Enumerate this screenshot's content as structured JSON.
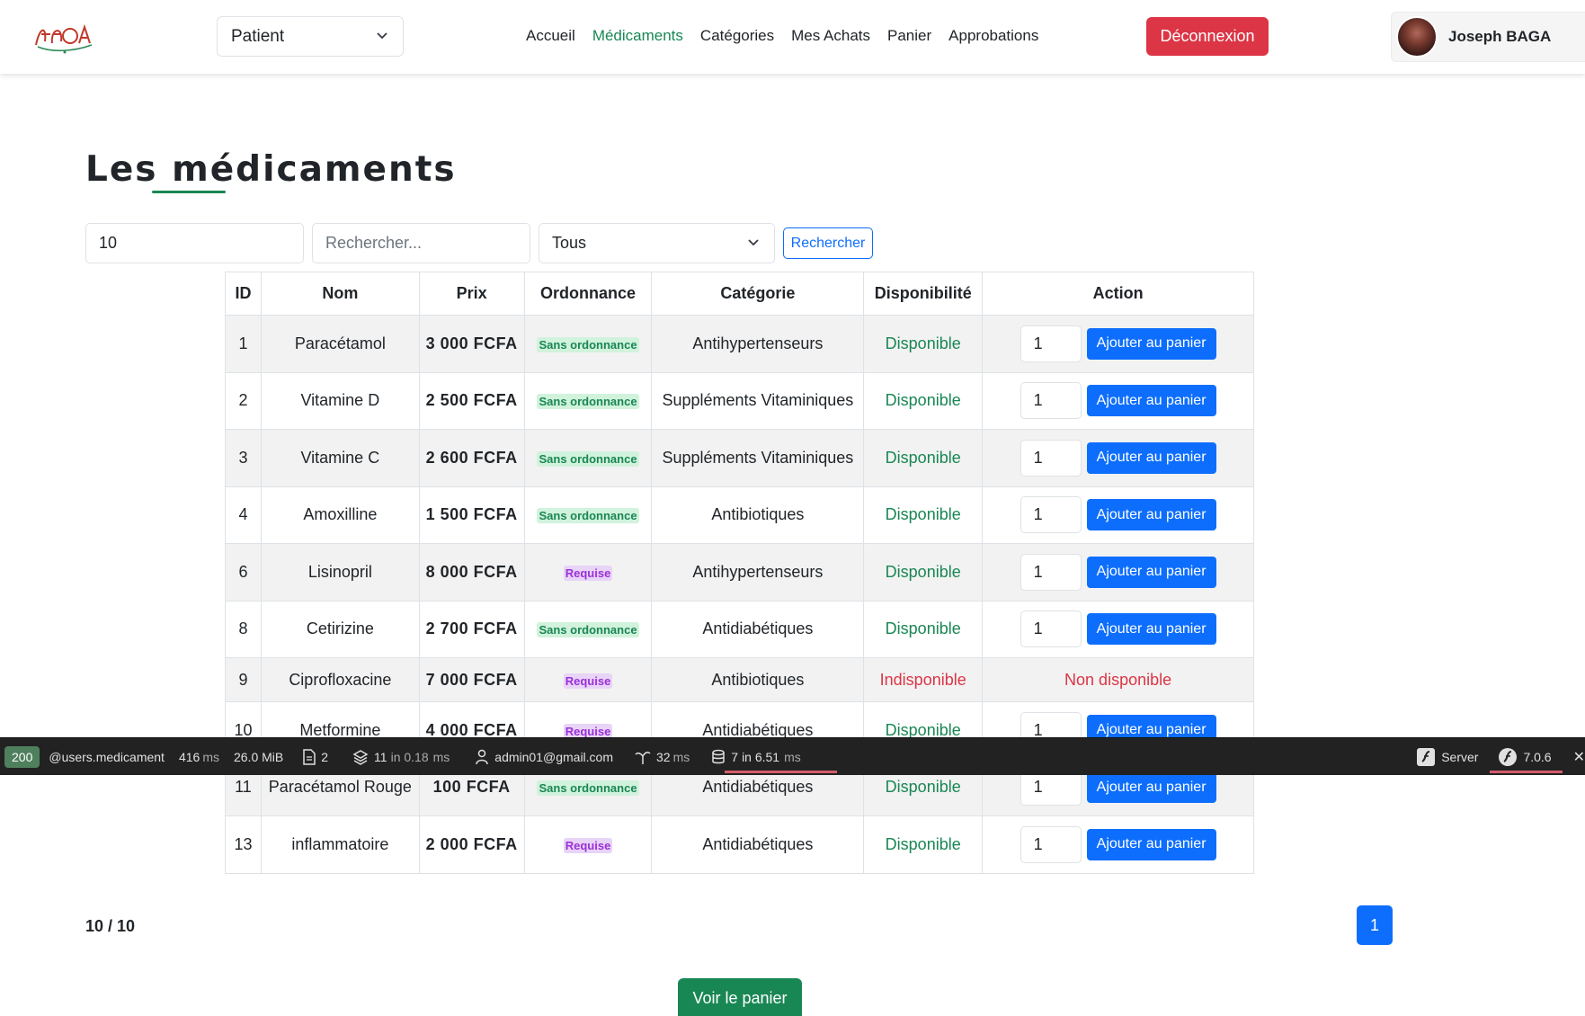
{
  "header": {
    "role_value": "Patient",
    "nav": [
      "Accueil",
      "Médicaments",
      "Catégories",
      "Mes Achats",
      "Panier",
      "Approbations"
    ],
    "logout_label": "Déconnexion",
    "user_name": "Joseph BAGA"
  },
  "title": "Les médicaments",
  "filters": {
    "limit_value": "10",
    "search_placeholder": "Rechercher...",
    "category_value": "Tous",
    "search_button": "Rechercher"
  },
  "table": {
    "headers": [
      "ID",
      "Nom",
      "Prix",
      "Ordonnance",
      "Catégorie",
      "Disponibilité",
      "Action"
    ],
    "rows": [
      {
        "id": "1",
        "nom": "Paracétamol",
        "prix": "3 000 FCFA",
        "ordonnance": "Sans ordonnance",
        "categorie": "Antihypertenseurs",
        "dispo": "Disponible",
        "qty": "1",
        "action": "Ajouter au panier"
      },
      {
        "id": "2",
        "nom": "Vitamine D",
        "prix": "2 500 FCFA",
        "ordonnance": "Sans ordonnance",
        "categorie": "Suppléments Vitaminiques",
        "dispo": "Disponible",
        "qty": "1",
        "action": "Ajouter au panier"
      },
      {
        "id": "3",
        "nom": "Vitamine C",
        "prix": "2 600 FCFA",
        "ordonnance": "Sans ordonnance",
        "categorie": "Suppléments Vitaminiques",
        "dispo": "Disponible",
        "qty": "1",
        "action": "Ajouter au panier"
      },
      {
        "id": "4",
        "nom": "Amoxilline",
        "prix": "1 500 FCFA",
        "ordonnance": "Sans ordonnance",
        "categorie": "Antibiotiques",
        "dispo": "Disponible",
        "qty": "1",
        "action": "Ajouter au panier"
      },
      {
        "id": "6",
        "nom": "Lisinopril",
        "prix": "8 000 FCFA",
        "ordonnance": "Requise",
        "categorie": "Antihypertenseurs",
        "dispo": "Disponible",
        "qty": "1",
        "action": "Ajouter au panier"
      },
      {
        "id": "8",
        "nom": "Cetirizine",
        "prix": "2 700 FCFA",
        "ordonnance": "Sans ordonnance",
        "categorie": "Antidiabétiques",
        "dispo": "Disponible",
        "qty": "1",
        "action": "Ajouter au panier"
      },
      {
        "id": "9",
        "nom": "Ciprofloxacine",
        "prix": "7 000 FCFA",
        "ordonnance": "Requise",
        "categorie": "Antibiotiques",
        "dispo": "Indisponible",
        "qty": "",
        "action": "Non disponible"
      },
      {
        "id": "10",
        "nom": "Metformine",
        "prix": "4 000 FCFA",
        "ordonnance": "Requise",
        "categorie": "Antidiabétiques",
        "dispo": "Disponible",
        "qty": "1",
        "action": "Ajouter au panier"
      },
      {
        "id": "11",
        "nom": "Paracétamol Rouge",
        "prix": "100 FCFA",
        "ordonnance": "Sans ordonnance",
        "categorie": "Antidiabétiques",
        "dispo": "Disponible",
        "qty": "1",
        "action": "Ajouter au panier"
      },
      {
        "id": "13",
        "nom": "inflammatoire",
        "prix": "2 000 FCFA",
        "ordonnance": "Requise",
        "categorie": "Antidiabétiques",
        "dispo": "Disponible",
        "qty": "1",
        "action": "Ajouter au panier"
      }
    ]
  },
  "pagination": {
    "count_label": "10 / 10",
    "current_page": "1"
  },
  "cart_button": "Voir le panier",
  "debug_toolbar": {
    "status": "200",
    "route": "@users.medicament",
    "time_value": "416",
    "time_unit": "ms",
    "memory": "26.0 MiB",
    "forms_count": "2",
    "cache_value": "11",
    "cache_detail": "in 0.18",
    "cache_unit": "ms",
    "user": "admin01@gmail.com",
    "twig_value": "32",
    "twig_unit": "ms",
    "db_value": "7",
    "db_detail": "in 6.51",
    "db_unit": "ms",
    "server_label": "Server",
    "version": "7.0.6",
    "close": "✕"
  },
  "colors": {
    "accent_green": "#198754",
    "danger_red": "#dc3545",
    "primary_blue": "#0d6efd",
    "badge_purple": "#9b30d9"
  }
}
